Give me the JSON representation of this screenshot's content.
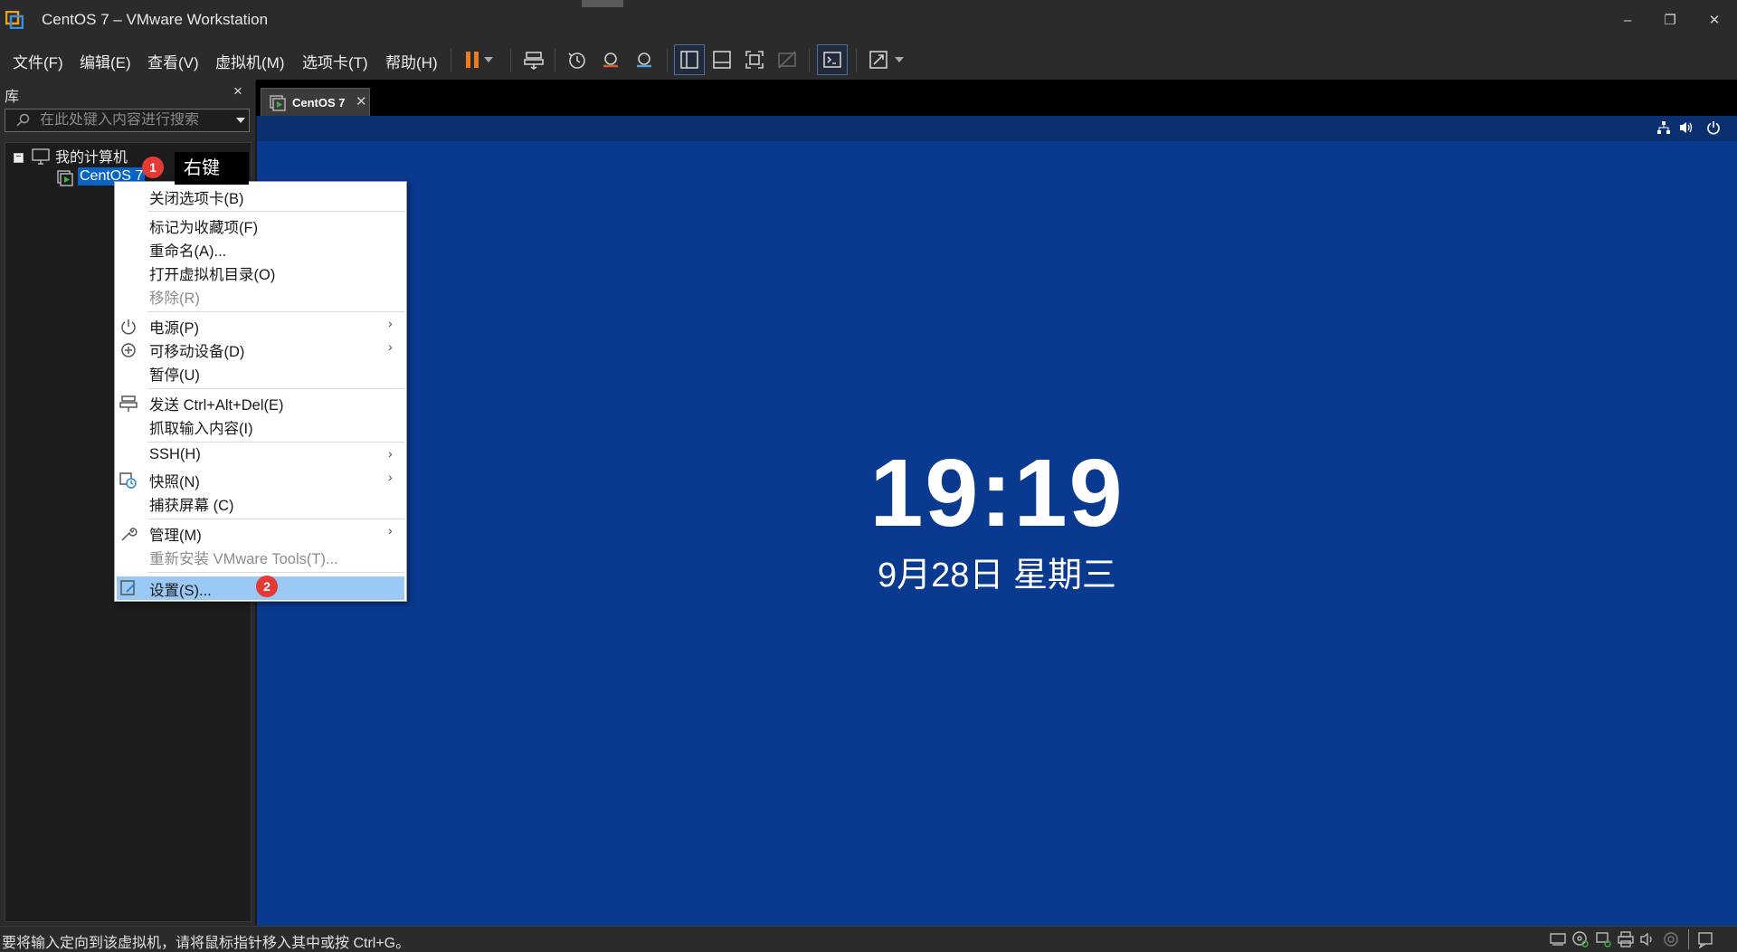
{
  "window": {
    "title": "CentOS 7 – VMware Workstation",
    "controls": {
      "minimize": "–",
      "restore": "❐",
      "close": "✕"
    }
  },
  "menubar": {
    "items": [
      "文件(F)",
      "编辑(E)",
      "查看(V)",
      "虚拟机(M)",
      "选项卡(T)",
      "帮助(H)"
    ]
  },
  "toolbar": {
    "icons": [
      "pause-icon",
      "dropdown-icon",
      "send-ctrl-alt-del-icon",
      "snapshot-icon",
      "revert-snapshot-icon",
      "snapshot-manager-icon",
      "view-library-icon",
      "view-thumbnail-icon",
      "full-screen-icon",
      "unity-icon",
      "console-icon",
      "stretch-icon"
    ],
    "accent": "#f07a1a"
  },
  "library": {
    "title": "库",
    "close": "×",
    "search_placeholder": "在此处键入内容进行搜索",
    "tree": {
      "root_label": "我的计算机",
      "expander": "−",
      "vm_label": "CentOS 7"
    }
  },
  "tabs": [
    {
      "label": "CentOS 7",
      "close": "✕"
    }
  ],
  "vm_screen": {
    "clock": "19:19",
    "date": "9月28日 星期三",
    "background": "#0a3a90"
  },
  "context_menu": {
    "items": [
      {
        "label": "关闭选项卡(B)",
        "enabled": true
      },
      {
        "label": "标记为收藏项(F)",
        "enabled": true
      },
      {
        "label": "重命名(A)...",
        "enabled": true
      },
      {
        "label": "打开虚拟机目录(O)",
        "enabled": true
      },
      {
        "label": "移除(R)",
        "enabled": false
      },
      {
        "label": "电源(P)",
        "enabled": true,
        "submenu": true,
        "icon": "power-icon"
      },
      {
        "label": "可移动设备(D)",
        "enabled": true,
        "submenu": true,
        "icon": "removable-devices-icon"
      },
      {
        "label": "暂停(U)",
        "enabled": true
      },
      {
        "label": "发送 Ctrl+Alt+Del(E)",
        "enabled": true,
        "icon": "send-keys-icon"
      },
      {
        "label": "抓取输入内容(I)",
        "enabled": true
      },
      {
        "label": "SSH(H)",
        "enabled": true,
        "submenu": true
      },
      {
        "label": "快照(N)",
        "enabled": true,
        "submenu": true,
        "icon": "snapshot-icon"
      },
      {
        "label": "捕获屏幕 (C)",
        "enabled": true
      },
      {
        "label": "管理(M)",
        "enabled": true,
        "submenu": true,
        "icon": "wrench-icon"
      },
      {
        "label": "重新安装 VMware Tools(T)...",
        "enabled": false
      },
      {
        "label": "设置(S)...",
        "enabled": true,
        "highlighted": true,
        "icon": "settings-icon"
      }
    ],
    "submenu_arrow": "›"
  },
  "annotations": {
    "badge1": "1",
    "badge2": "2",
    "callout": "右键",
    "badge_color": "#e53935"
  },
  "statusbar": {
    "text": "要将输入定向到该虚拟机，请将鼠标指针移入其中或按 Ctrl+G。"
  }
}
